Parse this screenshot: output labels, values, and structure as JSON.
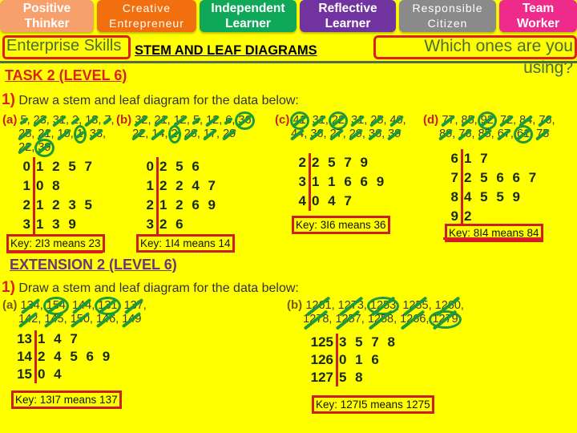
{
  "skills": [
    {
      "line1": "Positive",
      "line2": "Thinker",
      "color": "#f7a06b"
    },
    {
      "line1": "Creative",
      "line2": "Entrepreneur",
      "color": "#f26f10"
    },
    {
      "line1": "Independent",
      "line2": "Learner",
      "color": "#0fa758"
    },
    {
      "line1": "Reflective",
      "line2": "Learner",
      "color": "#7133a0"
    },
    {
      "line1": "Responsible",
      "line2": "Citizen",
      "color": "#8a8a8a"
    },
    {
      "line1": "Team",
      "line2": "Worker",
      "color": "#ee2a8b"
    }
  ],
  "header": {
    "enterprise_label": "Enterprise Skills",
    "title": "STEM AND LEAF DIAGRAMS",
    "which_prompt": "Which ones are you using?"
  },
  "task": {
    "heading": "TASK 2 (LEVEL 6)",
    "q_number": "1)",
    "instruction": "Draw a stem and leaf diagram for the data below:",
    "parts": [
      {
        "label": "(a)",
        "values": [
          "5",
          "23",
          "31",
          "2",
          "18",
          "7",
          "25",
          "21",
          "10",
          "1",
          "33",
          "22",
          "39"
        ],
        "circled": [
          "1",
          "39"
        ],
        "diagram": [
          {
            "stem": "0",
            "leaves": "1 2 5 7"
          },
          {
            "stem": "1",
            "leaves": "0 8"
          },
          {
            "stem": "2",
            "leaves": "1 2 3 5"
          },
          {
            "stem": "3",
            "leaves": "1 3 9"
          }
        ],
        "key": "Key: 2I3 means 23"
      },
      {
        "label": "(b)",
        "values": [
          "32",
          "21",
          "12",
          "5",
          "12",
          "6",
          "36",
          "22",
          "14",
          "2",
          "26",
          "17",
          "29"
        ],
        "circled": [
          "36",
          "2"
        ],
        "diagram": [
          {
            "stem": "0",
            "leaves": "2 5 6"
          },
          {
            "stem": "1",
            "leaves": "2 2 4 7"
          },
          {
            "stem": "2",
            "leaves": "1 2 6 9"
          },
          {
            "stem": "3",
            "leaves": "2 6"
          }
        ],
        "key": "Key: 1I4 means 14"
      },
      {
        "label": "(c)",
        "values": [
          "41",
          "31",
          "22",
          "31",
          "25",
          "40",
          "44",
          "36",
          "27",
          "29",
          "36",
          "39"
        ],
        "circled": [
          "41",
          "22"
        ],
        "diagram": [
          {
            "stem": "2",
            "leaves": "2 5 7 9"
          },
          {
            "stem": "3",
            "leaves": "1 1 6 6 9"
          },
          {
            "stem": "4",
            "leaves": "0 4 7"
          }
        ],
        "key": "Key: 3I6 means 36"
      },
      {
        "label": "(d)",
        "values": [
          "77",
          "85",
          "92",
          "72",
          "84",
          "76",
          "89",
          "76",
          "85",
          "67",
          "61",
          "75"
        ],
        "circled": [
          "92",
          "61"
        ],
        "diagram": [
          {
            "stem": "6",
            "leaves": "1 7"
          },
          {
            "stem": "7",
            "leaves": "2 5 6 6 7"
          },
          {
            "stem": "8",
            "leaves": "4 5 5 9"
          },
          {
            "stem": "9",
            "leaves": "2"
          }
        ],
        "key": "Key: 8I4 means 84"
      }
    ]
  },
  "extension": {
    "heading": "EXTENSION 2 (LEVEL 6)",
    "q_number": "1)",
    "instruction": "Draw a stem and leaf diagram for the data below:",
    "parts": [
      {
        "label": "(a)",
        "values": [
          "134",
          "154",
          "144",
          "131",
          "137",
          "142",
          "145",
          "150",
          "146",
          "149"
        ],
        "circled": [
          "154",
          "131"
        ],
        "diagram": [
          {
            "stem": "13",
            "leaves": "1 4 7"
          },
          {
            "stem": "14",
            "leaves": "2 4 5 6 9"
          },
          {
            "stem": "15",
            "leaves": "0 4"
          }
        ],
        "key": "Key: 13I7 means 137"
      },
      {
        "label": "(b)",
        "values": [
          "1261",
          "1273",
          "1253",
          "1255",
          "1260",
          "1278",
          "1257",
          "1258",
          "1266",
          "1279"
        ],
        "circled": [
          "1253",
          "1279"
        ],
        "diagram": [
          {
            "stem": "125",
            "leaves": "3 5 7 8"
          },
          {
            "stem": "126",
            "leaves": "0 1 6"
          },
          {
            "stem": "127",
            "leaves": "5 8"
          }
        ],
        "key": "Key: 127I5 means 1275"
      }
    ]
  }
}
